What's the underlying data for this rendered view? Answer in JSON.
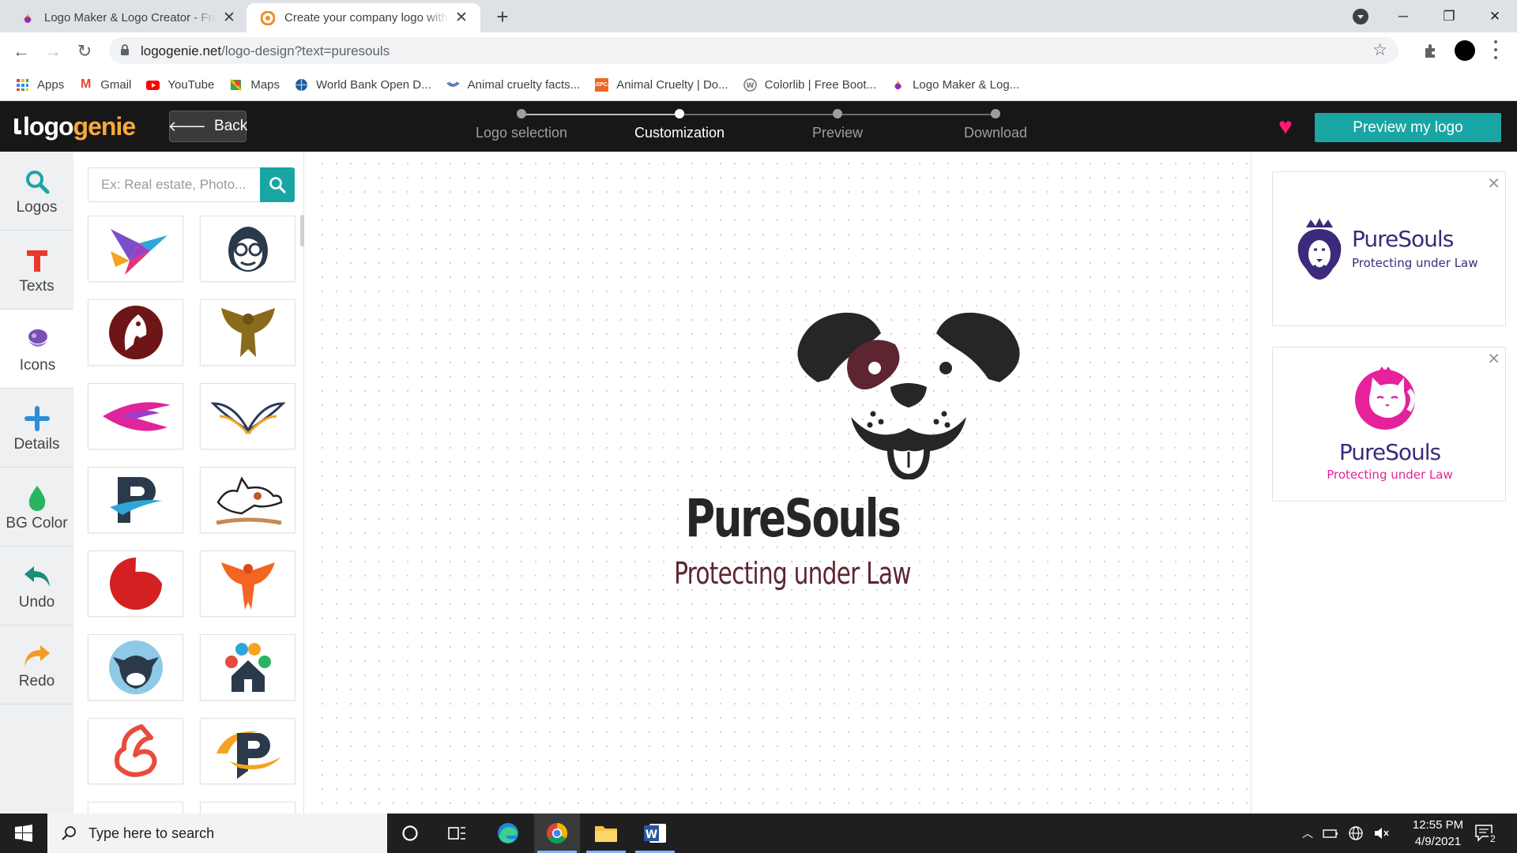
{
  "browser": {
    "tabs": [
      {
        "title": "Logo Maker & Logo Creator - Free",
        "active": false
      },
      {
        "title": "Create your company logo with our",
        "active": true
      }
    ],
    "new_tab": "+",
    "window_controls": {
      "minimize": "─",
      "maximize": "❐",
      "close": "✕"
    },
    "url_host": "logogenie.net",
    "url_path": "/logo-design?text=puresouls",
    "bookmarks": [
      "Apps",
      "Gmail",
      "YouTube",
      "Maps",
      "World Bank Open D...",
      "Animal cruelty facts...",
      "Animal Cruelty | Do...",
      "Colorlib | Free Boot...",
      "Logo Maker & Log..."
    ]
  },
  "app": {
    "logo_part1": "logo",
    "logo_part2": "genie",
    "back_label": "Back",
    "steps": [
      {
        "label": "Logo selection",
        "active": false
      },
      {
        "label": "Customization",
        "active": true
      },
      {
        "label": "Preview",
        "active": false
      },
      {
        "label": "Download",
        "active": false
      }
    ],
    "preview_label": "Preview my logo",
    "accent_color": "#1aa5a5",
    "heart_color": "#ff1a75"
  },
  "sidebar": {
    "items": [
      {
        "label": "Logos",
        "icon": "search-icon"
      },
      {
        "label": "Texts",
        "icon": "text-icon"
      },
      {
        "label": "Icons",
        "icon": "icons-icon",
        "active": true
      },
      {
        "label": "Details",
        "icon": "plus-icon"
      },
      {
        "label": "BG Color",
        "icon": "drop-icon"
      },
      {
        "label": "Undo",
        "icon": "undo-icon"
      },
      {
        "label": "Redo",
        "icon": "redo-icon"
      }
    ]
  },
  "library": {
    "search_placeholder": "Ex: Real estate, Photo...",
    "thumbnails": [
      "origami-bird",
      "hipster-monkey",
      "horse-head",
      "eagle",
      "pink-swoosh",
      "wings",
      "letter-p",
      "running-dog",
      "red-swirl",
      "phoenix",
      "cow-head",
      "paw-house",
      "fox",
      "letter-p-orbit"
    ]
  },
  "canvas": {
    "brand_name": "PureSouls",
    "tagline": "Protecting under Law",
    "brand_color": "#262626",
    "tagline_color": "#5d2530"
  },
  "saved_logos": [
    {
      "name": "PureSouls",
      "tagline": "Protecting under Law",
      "color": "#3d2a7a"
    },
    {
      "name": "PureSouls",
      "tagline": "Protecting under Law",
      "color": "#e5219c"
    }
  ],
  "taskbar": {
    "search_placeholder": "Type here to search",
    "time": "12:55 PM",
    "date": "4/9/2021",
    "notifications": "2"
  }
}
